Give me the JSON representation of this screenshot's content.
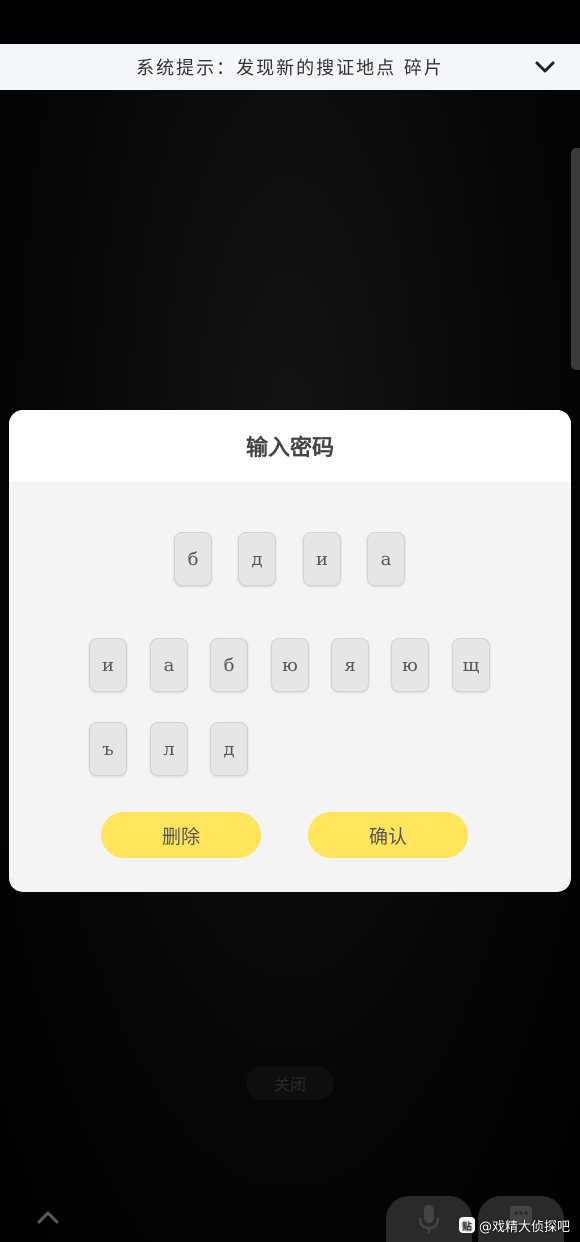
{
  "notice": {
    "text": "系统提示：发现新的搜证地点 碎片",
    "collapse_icon": "chevron-down-icon"
  },
  "dialog": {
    "title": "输入密码",
    "password_slots": [
      "б",
      "д",
      "и",
      "а"
    ],
    "keys": [
      "и",
      "а",
      "б",
      "ю",
      "я",
      "ю",
      "щ",
      "ъ",
      "л",
      "д"
    ],
    "delete_label": "删除",
    "confirm_label": "确认",
    "accent_color": "#ffe45c"
  },
  "bottom": {
    "close_label": "关闭",
    "expand_icon": "chevron-up-icon",
    "voice_icon": "microphone-icon",
    "keyboard_icon": "keyboard-icon"
  },
  "watermark": {
    "badge": "贴",
    "text": "@戏精大侦探吧"
  }
}
